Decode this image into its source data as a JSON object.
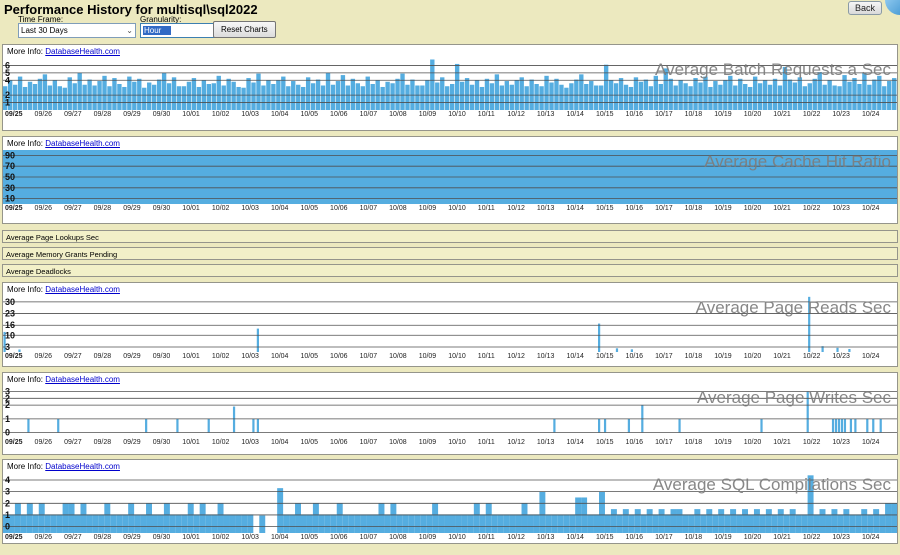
{
  "window": {
    "title": "Performance History for multisql\\sql2022",
    "back_label": "Back"
  },
  "controls": {
    "time_frame_label": "Time Frame:",
    "time_frame_value": "Last 30 Days",
    "granularity_label": "Granularity:",
    "granularity_value": "Hour",
    "reset_button": "Reset Charts"
  },
  "more_info": {
    "label": "More Info:",
    "link": "DatabaseHealth.com"
  },
  "collapsed_panels": [
    "Average Page Lookups Sec",
    "Average Memory Grants Pending",
    "Average Deadlocks"
  ],
  "colors": {
    "bar": "#55ADE0",
    "grid": "#4F4F4F",
    "page_bg": "#ECE9BF",
    "panel_bg": "#FFFFFF",
    "link": "#0000CC",
    "title_gray": "#7D7D7D",
    "select_highlight": "#316AC5"
  },
  "dates": [
    "09/25",
    "09/26",
    "09/27",
    "09/28",
    "09/29",
    "09/30",
    "10/01",
    "10/02",
    "10/03",
    "10/04",
    "10/05",
    "10/06",
    "10/07",
    "10/08",
    "10/09",
    "10/10",
    "10/11",
    "10/12",
    "10/13",
    "10/14",
    "10/15",
    "10/16",
    "10/17",
    "10/18",
    "10/19",
    "10/20",
    "10/21",
    "10/22",
    "10/23",
    "10/24"
  ],
  "chart_data": [
    {
      "type": "bar",
      "title": "Average Batch Requests a Sec",
      "ylabel": "",
      "xlabel": "",
      "ylim": [
        0,
        7
      ],
      "gap": 0.6,
      "yticks": [
        {
          "v": 6,
          "label": "6"
        },
        {
          "v": 5,
          "label": "5"
        },
        {
          "v": 4,
          "label": "4"
        },
        {
          "v": 2,
          "label": "2"
        },
        {
          "v": 1,
          "label": "1"
        }
      ],
      "values": [
        3.2,
        4.0,
        3.4,
        4.5,
        3.1,
        3.8,
        3.5,
        4.2,
        4.8,
        3.3,
        4.0,
        3.2,
        3.0,
        4.4,
        3.6,
        5.0,
        3.4,
        4.1,
        3.3,
        3.9,
        4.6,
        3.2,
        4.3,
        3.5,
        3.1,
        4.5,
        3.8,
        4.2,
        3.0,
        3.7,
        3.4,
        4.1,
        5.0,
        3.6,
        4.4,
        3.2,
        3.2,
        3.8,
        4.3,
        3.1,
        4.0,
        3.5,
        3.6,
        4.6,
        3.3,
        4.2,
        3.8,
        3.1,
        3.0,
        4.3,
        3.7,
        4.9,
        3.3,
        4.0,
        3.5,
        4.0,
        4.5,
        3.2,
        3.9,
        3.4,
        3.1,
        4.4,
        3.6,
        4.1,
        3.3,
        5.0,
        3.4,
        3.9,
        4.7,
        3.3,
        4.2,
        3.6,
        3.2,
        4.5,
        3.5,
        4.0,
        3.1,
        3.8,
        3.6,
        4.2,
        4.9,
        3.4,
        4.1,
        3.3,
        3.3,
        4.0,
        6.8,
        3.7,
        4.4,
        3.2,
        3.5,
        6.2,
        3.8,
        4.3,
        3.4,
        4.0,
        3.1,
        4.2,
        3.6,
        4.8,
        3.3,
        3.9,
        3.4,
        4.0,
        4.4,
        3.2,
        4.1,
        3.5,
        3.2,
        4.6,
        3.7,
        4.2,
        3.4,
        3.0,
        3.6,
        4.1,
        4.8,
        3.5,
        3.9,
        3.3,
        3.3,
        6.1,
        4.0,
        3.6,
        4.3,
        3.4,
        3.1,
        4.4,
        3.8,
        4.1,
        3.2,
        4.6,
        3.5,
        5.6,
        4.2,
        3.3,
        4.0,
        3.6,
        3.2,
        4.3,
        3.7,
        4.5,
        3.1,
        3.9,
        3.4,
        4.0,
        4.6,
        3.3,
        4.2,
        3.5,
        3.1,
        4.5,
        3.6,
        4.0,
        3.4,
        4.2,
        3.3,
        5.8,
        4.1,
        3.7,
        4.4,
        3.2,
        3.6,
        4.2,
        5.1,
        3.4,
        4.0,
        3.3,
        3.2,
        4.7,
        3.8,
        4.3,
        3.5,
        5.0,
        3.4,
        4.1,
        4.6,
        3.2,
        3.9,
        4.3
      ]
    },
    {
      "type": "area",
      "title": "Average Cache Hit Ratio",
      "ylabel": "",
      "xlabel": "",
      "ylim": [
        0,
        100
      ],
      "fill": 100,
      "yticks": [
        {
          "v": 90,
          "label": "90"
        },
        {
          "v": 70,
          "label": "70"
        },
        {
          "v": 50,
          "label": "50"
        },
        {
          "v": 30,
          "label": "30"
        },
        {
          "v": 10,
          "label": "10"
        }
      ]
    },
    {
      "type": "bar",
      "title": "Average Page Reads Sec",
      "ylabel": "",
      "xlabel": "",
      "ylim": [
        0,
        33.5
      ],
      "base": 0,
      "yticks": [
        {
          "v": 30,
          "label": "30"
        },
        {
          "v": 23,
          "label": "23"
        },
        {
          "v": 16,
          "label": "16"
        },
        {
          "v": 10,
          "label": "10"
        },
        {
          "v": 3,
          "label": "3"
        }
      ],
      "points": [
        [
          0.05,
          12
        ],
        [
          0.55,
          1.5
        ],
        [
          8.55,
          14
        ],
        [
          20.0,
          17
        ],
        [
          20.6,
          2.2
        ],
        [
          21.1,
          1.6
        ],
        [
          27.05,
          33
        ],
        [
          27.5,
          3.5
        ],
        [
          28.0,
          2.5
        ],
        [
          28.4,
          1.8
        ]
      ]
    },
    {
      "type": "bar",
      "title": "Average Page Writes Sec",
      "ylabel": "",
      "xlabel": "",
      "ylim": [
        -0.4,
        3.4
      ],
      "base": 0,
      "yticks": [
        {
          "v": 3,
          "label": "3"
        },
        {
          "v": 2.5,
          "label": "2"
        },
        {
          "v": 2,
          "label": "2"
        },
        {
          "v": 1,
          "label": "1"
        },
        {
          "v": 0,
          "label": "0"
        }
      ],
      "points": [
        [
          0.85,
          1
        ],
        [
          1.85,
          1
        ],
        [
          4.8,
          1
        ],
        [
          5.85,
          1
        ],
        [
          6.9,
          1
        ],
        [
          7.75,
          1.9
        ],
        [
          8.4,
          1
        ],
        [
          8.55,
          1
        ],
        [
          18.5,
          1
        ],
        [
          20.0,
          1
        ],
        [
          20.2,
          1
        ],
        [
          21.0,
          1
        ],
        [
          21.45,
          2
        ],
        [
          22.7,
          1
        ],
        [
          25.45,
          1
        ],
        [
          27.0,
          3
        ],
        [
          27.85,
          1
        ],
        [
          27.95,
          1
        ],
        [
          28.05,
          1
        ],
        [
          28.15,
          1
        ],
        [
          28.25,
          1
        ],
        [
          28.45,
          1
        ],
        [
          28.6,
          1
        ],
        [
          29.0,
          1
        ],
        [
          29.2,
          1
        ],
        [
          29.45,
          1
        ]
      ]
    },
    {
      "type": "bar",
      "title": "Average SQL Compilations Sec",
      "ylabel": "",
      "xlabel": "",
      "ylim": [
        -0.55,
        4.6
      ],
      "gap": 0,
      "yticks": [
        {
          "v": 4,
          "label": "4"
        },
        {
          "v": 3,
          "label": "3"
        },
        {
          "v": 2,
          "label": "2"
        },
        {
          "v": 1,
          "label": "1"
        },
        {
          "v": 0,
          "label": "0"
        }
      ],
      "values": [
        1.05,
        1.05,
        2.0,
        1.05,
        2.0,
        1.05,
        2.0,
        1.05,
        1.05,
        1.05,
        2.0,
        2.0,
        1.05,
        2.0,
        1.05,
        1.05,
        1.05,
        2.0,
        1.05,
        1.05,
        1.05,
        2.0,
        1.05,
        1.05,
        2.0,
        1.05,
        1.05,
        2.0,
        1.05,
        1.05,
        1.05,
        2.0,
        1.05,
        2.0,
        1.05,
        1.05,
        2.0,
        1.05,
        1.05,
        1.05,
        1.05,
        1.05,
        0,
        0.95,
        0,
        0,
        3.3,
        1.05,
        1.05,
        2.0,
        1.05,
        1.05,
        2.0,
        1.05,
        1.05,
        1.05,
        2.0,
        1.05,
        1.05,
        1.05,
        1.05,
        1.05,
        1.05,
        2.0,
        1.05,
        2.0,
        1.05,
        1.05,
        1.05,
        1.05,
        1.05,
        1.05,
        2.0,
        1.05,
        1.05,
        1.05,
        1.05,
        1.05,
        1.05,
        2.0,
        1.05,
        2.0,
        1.05,
        1.05,
        1.05,
        1.05,
        1.05,
        2.0,
        1.05,
        1.05,
        3.0,
        1.05,
        1.05,
        1.05,
        1.05,
        1.05,
        2.5,
        2.5,
        1.05,
        1.05,
        3.0,
        1.05,
        1.5,
        1.05,
        1.5,
        1.05,
        1.5,
        1.05,
        1.5,
        1.05,
        1.5,
        1.05,
        1.5,
        1.5,
        1.05,
        1.05,
        1.5,
        1.05,
        1.5,
        1.05,
        1.5,
        1.05,
        1.5,
        1.05,
        1.5,
        1.05,
        1.5,
        1.05,
        1.5,
        1.05,
        1.5,
        1.05,
        1.5,
        1.05,
        1.05,
        4.4,
        1.05,
        1.5,
        1.05,
        1.5,
        1.05,
        1.5,
        1.05,
        1.05,
        1.5,
        1.05,
        1.5,
        1.05,
        2.0,
        2.0
      ]
    }
  ]
}
